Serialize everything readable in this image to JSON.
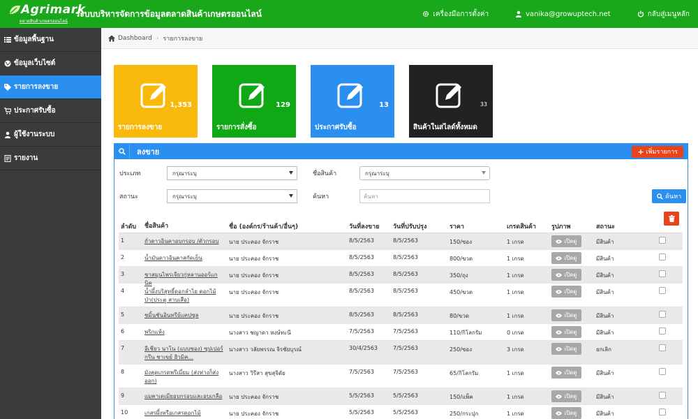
{
  "header": {
    "logo_text": "Agrimark",
    "logo_sub": "ตลาดสินค้าเกษตรออนไลน์",
    "app_title": "ระบบบริหารจัดการข้อมูลตลาดสินค้าเกษตรออนไลน์",
    "settings_label": "เครื่องมือการตั้งค่า",
    "user_email": "vanika@growuptech.net",
    "home_label": "กลับสู่เมนูหลัก"
  },
  "sidebar": {
    "items": [
      {
        "label": "ข้อมูลพื้นฐาน",
        "icon": "list-icon"
      },
      {
        "label": "ข้อมูลเว็บไซต์",
        "icon": "globe-icon"
      },
      {
        "label": "รายการลงขาย",
        "icon": "tag-icon"
      },
      {
        "label": "ประกาศรับซื้อ",
        "icon": "cart-icon"
      },
      {
        "label": "ผู้ใช้งานระบบ",
        "icon": "user-icon"
      },
      {
        "label": "รายงาน",
        "icon": "report-icon"
      }
    ]
  },
  "breadcrumb": {
    "home": "Dashboard",
    "current": "รายการลงขาย"
  },
  "tiles": [
    {
      "label": "รายการลงขาย",
      "count": "1,353",
      "color": "#f9b90c"
    },
    {
      "label": "รายการสั่งซื้อ",
      "count": "129",
      "color": "#10a814"
    },
    {
      "label": "ประกาศรับซื้อ",
      "count": "13",
      "color": "#2b8fef"
    },
    {
      "label": "สินค้าในสไลด์ทั้งหมด",
      "count": "33",
      "color": "#222222"
    }
  ],
  "panel": {
    "title": "ลงขาย",
    "add_button": "เพิ่มรายการ",
    "filters": {
      "type_label": "ประเภท",
      "type_value": "กรุณาระบุ",
      "product_label": "ชื่อสินค้า",
      "product_value": "กรุณาระบุ",
      "status_label": "สถานะ",
      "status_value": "กรุณาระบุ",
      "search_label": "ค้นหา",
      "search_placeholder": "ค้นหา",
      "search_button": "ค้นหา"
    },
    "columns": {
      "no": "ลำดับ",
      "name": "ชื่อสินค้า",
      "owner": "ชื่อ (องค์กร/ร้านค้า/อื่นๆ)",
      "listed": "วันที่ลงขาย",
      "updated": "วันที่ปรับปรุง",
      "price": "ราคา",
      "grade": "เกรดสินค้า",
      "picture": "รูปภาพ",
      "status": "สถานะ"
    },
    "view_label": "เปิดดู",
    "rows": [
      {
        "no": "1",
        "name": "ถั่วดาวอินคาอบกรอบ /ตัวกรอบ",
        "owner": "นาย ประคอง จักราช",
        "listed": "8/5/2563",
        "updated": "8/5/2563",
        "price": "150/ซอง",
        "grade": "1 เกรด",
        "status": "มีสินค้า"
      },
      {
        "no": "2",
        "name": "น้ำมันดาวอินคาสกัดเย็น",
        "owner": "นาย ประคอง จักราช",
        "listed": "8/5/2563",
        "updated": "8/5/2563",
        "price": "800/ขวด",
        "grade": "1 เกรด",
        "status": "มีสินค้า"
      },
      {
        "no": "3",
        "name": "ชาสมุนไพรเจียวกู่หลานออร์แกนิค",
        "owner": "นาย ประคอง จักราช",
        "listed": "8/5/2563",
        "updated": "8/5/2563",
        "price": "350/ถุง",
        "grade": "1 เกรด",
        "status": "มีสินค้า"
      },
      {
        "no": "4",
        "name": "น้ำผึ้งบริสุทธิ์ดอกลำไย ดอกไม้ป่า(ประตู สาบเสือ)",
        "owner": "นาย ประคอง จักราช",
        "listed": "8/5/2563",
        "updated": "8/5/2563",
        "price": "450/ขวด",
        "grade": "1 เกรด",
        "status": "มีสินค้า"
      },
      {
        "no": "5",
        "name": "ชมิ้นชันอินทรีย์แคปซูล",
        "owner": "นาย ประคอง จักราช",
        "listed": "8/5/2563",
        "updated": "8/5/2563",
        "price": "80/ขวด",
        "grade": "1 เกรด",
        "status": "มีสินค้า"
      },
      {
        "no": "6",
        "name": "พริกแห้ง",
        "owner": "นางสาว ชญาดา หงษ์ทะนี",
        "listed": "7/5/2563",
        "updated": "7/5/2563",
        "price": "110/กิโลกรัม",
        "grade": "0 เกรด",
        "status": "มีสินค้า"
      },
      {
        "no": "7",
        "name": "อีเชียว นาโน (แบบซอง) ซุปเปอร์กรีน ชาเขย์ ฮิวมิค...",
        "owner": "นางสาว วลัยพรรณ จิรชัยบุรณ์",
        "listed": "30/4/2563",
        "updated": "7/5/2563",
        "price": "250/ซอง",
        "grade": "3 เกรด",
        "status": "ยกเลิก"
      },
      {
        "no": "8",
        "name": "มังคุดเกรดพรีเมี่ยม (ส่งห่างก็ส่งออก)",
        "owner": "นางสาว วิรีสา สุขสุจิตัย",
        "listed": "7/5/2563",
        "updated": "7/5/2563",
        "price": "65/กิโลกรัม",
        "grade": "1 เกรด",
        "status": "มีสินค้า"
      },
      {
        "no": "9",
        "name": "แมคาเดเมียอบกรอบและอบเกลือ",
        "owner": "นาย ประคอง จักราช",
        "listed": "5/5/2563",
        "updated": "5/5/2563",
        "price": "150/แพ็ค",
        "grade": "1 เกรด",
        "status": "มีสินค้า"
      },
      {
        "no": "10",
        "name": "เกสรผึ้งหรือเกสรดอกไม้",
        "owner": "นาย ประคอง จักราช",
        "listed": "5/5/2563",
        "updated": "5/5/2563",
        "price": "250/กระปุก",
        "grade": "1 เกรด",
        "status": "มีสินค้า"
      }
    ]
  }
}
